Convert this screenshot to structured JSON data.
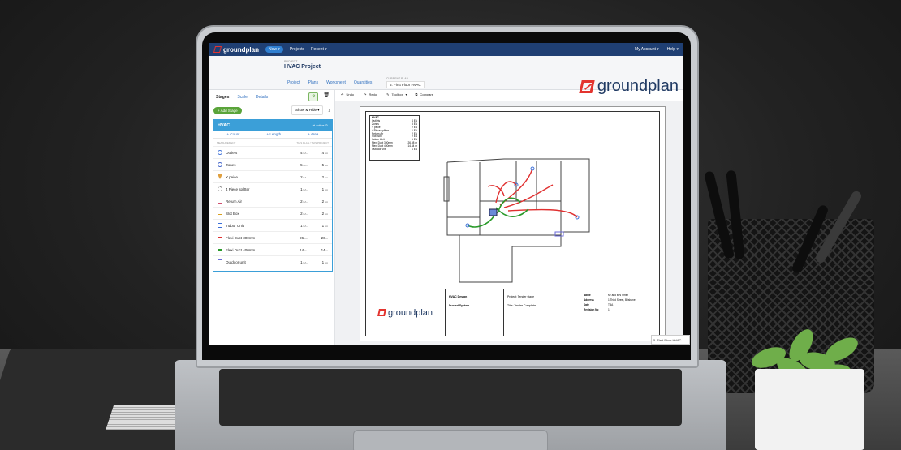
{
  "topbar": {
    "brand": "groundplan",
    "new_label": "New",
    "projects_label": "Projects",
    "recent_label": "Recent",
    "account_label": "My Account",
    "help_label": "Help"
  },
  "header": {
    "project_caption": "PROJECT",
    "project_title": "HVAC Project",
    "tabs": [
      "Project",
      "Plans",
      "Worksheet",
      "Quantities"
    ],
    "current_plan_caption": "CURRENT PLAN",
    "current_plan": "5. First Floor HVAC",
    "brand_big": "groundplan"
  },
  "panel": {
    "tabs": [
      "Stages",
      "Scale",
      "Details"
    ],
    "add_stage": "+ Add Stage",
    "show_hide": "Show & Hide",
    "stage_name": "HVAC",
    "stage_status": "active",
    "measure_buttons": [
      "+ Count",
      "+ Length",
      "+ Area"
    ],
    "col_left": "MEASUREMENT",
    "col_right": "THIS PLAN / THIS PROJECT",
    "items": [
      {
        "name": "Outlets",
        "plan": "4",
        "project": "4",
        "unit": "EA",
        "color": "#3b6fd8",
        "icon": "circle-outline-icon"
      },
      {
        "name": "Zones",
        "plan": "5",
        "project": "5",
        "unit": "EA",
        "color": "#3b5fc8",
        "icon": "circle-outline-icon"
      },
      {
        "name": "Y peice",
        "plan": "2",
        "project": "2",
        "unit": "EA",
        "color": "#e0a040",
        "icon": "triangle-icon"
      },
      {
        "name": "4 Piece splitter",
        "plan": "1",
        "project": "1",
        "unit": "EA",
        "color": "#888888",
        "icon": "dashed-circle-icon"
      },
      {
        "name": "Return Air",
        "plan": "2",
        "project": "2",
        "unit": "EA",
        "color": "#d05070",
        "icon": "square-icon"
      },
      {
        "name": "Slot Box",
        "plan": "2",
        "project": "2",
        "unit": "EA",
        "color": "#d9a020",
        "icon": "slot-icon"
      },
      {
        "name": "Indoor Unit",
        "plan": "1",
        "project": "1",
        "unit": "EA",
        "color": "#3b6fd8",
        "icon": "unit-icon"
      },
      {
        "name": "Flexi Duct 300mm",
        "plan": "26",
        "project": "26",
        "unit": "m",
        "color": "#e03030",
        "icon": "line-icon"
      },
      {
        "name": "Flexi Duct 400mm",
        "plan": "14",
        "project": "14",
        "unit": "m",
        "color": "#2a9a2a",
        "icon": "line-icon"
      },
      {
        "name": "Outdoor unit",
        "plan": "1",
        "project": "1",
        "unit": "EA",
        "color": "#6a6ad8",
        "icon": "rect-icon"
      }
    ]
  },
  "toolbar": {
    "undo": "Undo",
    "redo": "Redo",
    "toolbox": "Toolbox",
    "compare": "Compare"
  },
  "legend": {
    "title": "HVAC",
    "rows": [
      {
        "name": "Outlets",
        "qty": "4 EA"
      },
      {
        "name": "Zones",
        "qty": "5 EA"
      },
      {
        "name": "Y peice",
        "qty": "2 EA"
      },
      {
        "name": "4 Piece splitter",
        "qty": "1 EA"
      },
      {
        "name": "Return Air",
        "qty": "2 EA"
      },
      {
        "name": "Slot Box",
        "qty": "2 EA"
      },
      {
        "name": "Indoor Unit",
        "qty": "1 EA"
      },
      {
        "name": "Flexi Duct 300mm",
        "qty": "26.08 m"
      },
      {
        "name": "Flexi Duct 400mm",
        "qty": "14.44 m"
      },
      {
        "name": "Outdoor unit",
        "qty": "1 EA"
      }
    ]
  },
  "titleblock": {
    "brand": "groundplan",
    "design_title": "HVAC Design",
    "design_sub": "Ducted System",
    "project": "Project: Tender stage",
    "title": "Title: Tender Complete",
    "kv": [
      {
        "k": "Name",
        "v": "Mr and Mrs Smith"
      },
      {
        "k": "Address",
        "v": "1 Third Street, Brisbane"
      },
      {
        "k": "Date",
        "v": "TBA"
      },
      {
        "k": "Revision No",
        "v": "1"
      }
    ]
  },
  "tooltip": "5. First Floor HVAC"
}
